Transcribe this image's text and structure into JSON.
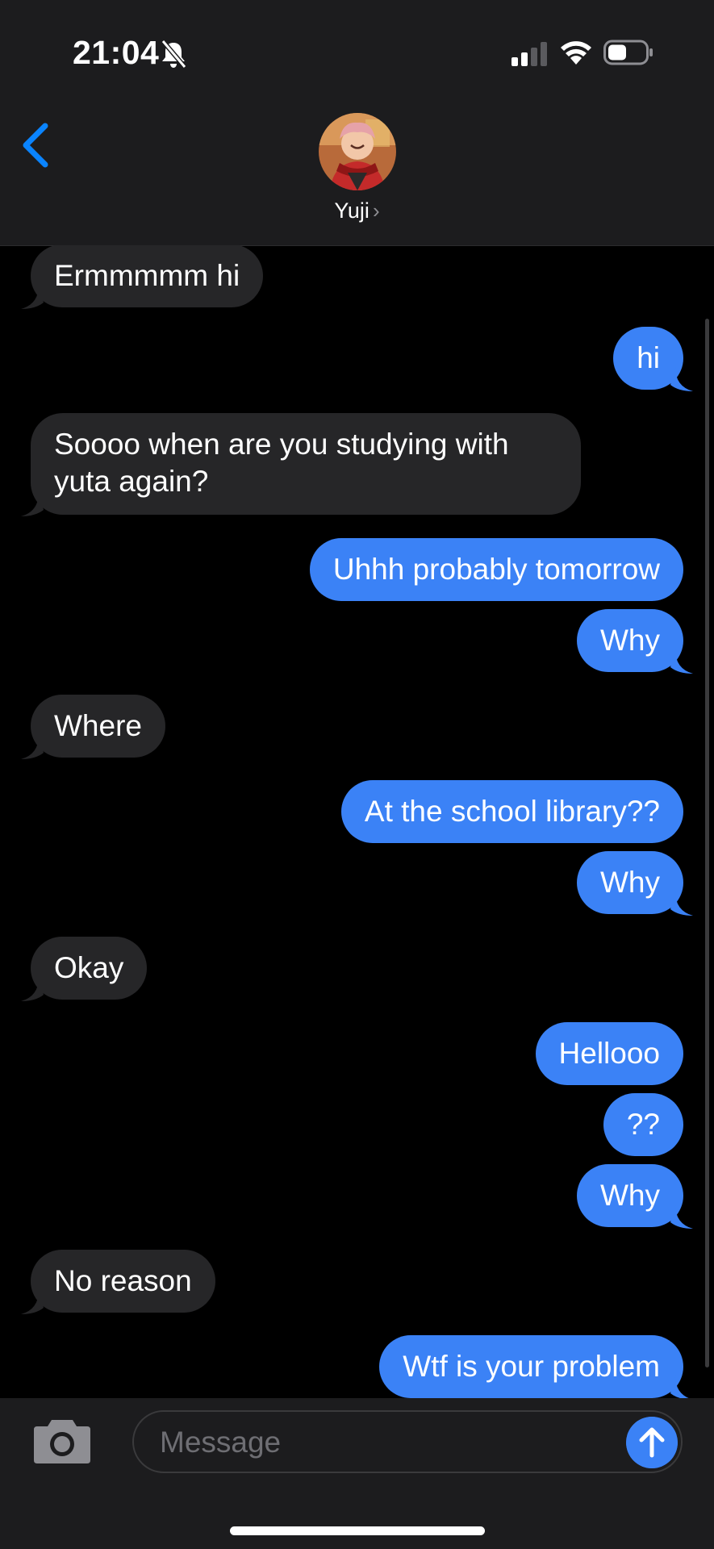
{
  "status_bar": {
    "time": "21:04"
  },
  "contact": {
    "name": "Yuji",
    "chevron": "›"
  },
  "messages": [
    {
      "text": "Ermmmmm hi",
      "dir": "in"
    },
    {
      "text": "hi",
      "dir": "out"
    },
    {
      "text": "Soooo when are you studying with yuta again?",
      "dir": "in"
    },
    {
      "text": "Uhhh probably tomorrow",
      "dir": "out"
    },
    {
      "text": "Why",
      "dir": "out"
    },
    {
      "text": "Where",
      "dir": "in"
    },
    {
      "text": "At the school library??",
      "dir": "out"
    },
    {
      "text": "Why",
      "dir": "out"
    },
    {
      "text": "Okay",
      "dir": "in"
    },
    {
      "text": "Hellooo",
      "dir": "out"
    },
    {
      "text": "??",
      "dir": "out"
    },
    {
      "text": "Why",
      "dir": "out"
    },
    {
      "text": "No reason",
      "dir": "in"
    },
    {
      "text": "Wtf is your problem",
      "dir": "out"
    }
  ],
  "composer": {
    "placeholder": "Message",
    "value": ""
  },
  "colors": {
    "outgoing": "#3b82f6",
    "incoming": "#262628",
    "accent": "#0a84ff"
  },
  "icons": [
    "back-chevron-icon",
    "bell-off-icon",
    "signal-icon",
    "wifi-icon",
    "battery-icon",
    "camera-icon",
    "send-arrow-icon"
  ]
}
